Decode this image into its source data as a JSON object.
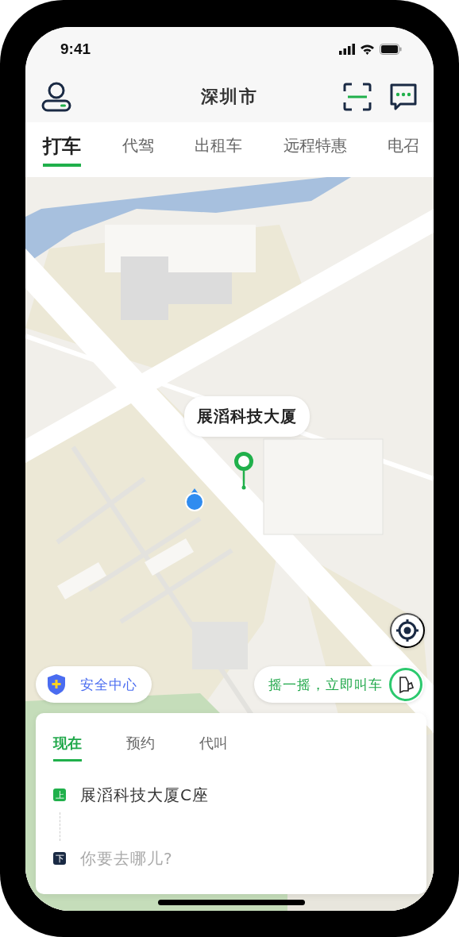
{
  "status_bar": {
    "time": "9:41"
  },
  "header": {
    "city": "深圳市"
  },
  "service_tabs": [
    {
      "label": "打车",
      "selected": true
    },
    {
      "label": "代驾",
      "selected": false
    },
    {
      "label": "出租车",
      "selected": false
    },
    {
      "label": "远程特惠",
      "selected": false
    },
    {
      "label": "电召",
      "selected": false
    }
  ],
  "map": {
    "place_callout": "展滔科技大厦",
    "safety_button": "安全中心",
    "shake_button": "摇一摇，立即叫车"
  },
  "ride_card": {
    "tabs": [
      {
        "label": "现在",
        "selected": true
      },
      {
        "label": "预约",
        "selected": false
      },
      {
        "label": "代叫",
        "selected": false
      }
    ],
    "pickup": {
      "badge": "上",
      "value": "展滔科技大厦C座"
    },
    "destination": {
      "badge": "下",
      "placeholder": "你要去哪儿?"
    }
  }
}
